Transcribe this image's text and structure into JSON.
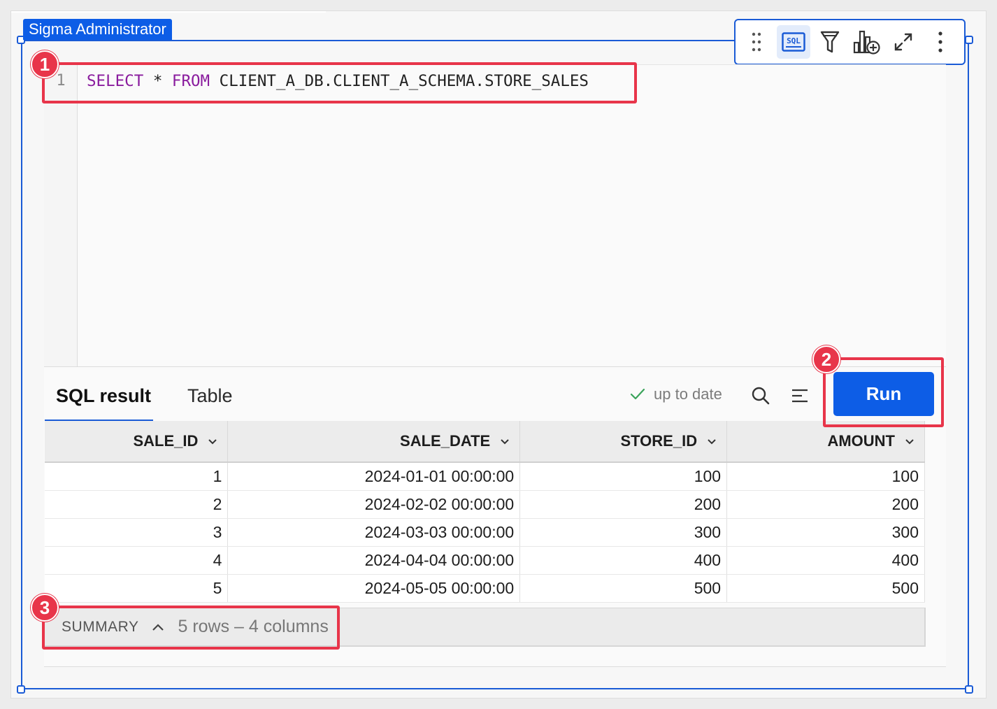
{
  "owner_tag": "Sigma Administrator",
  "toolbar": {
    "items": [
      {
        "icon": "drag-handle-icon"
      },
      {
        "icon": "sql-icon",
        "label": "SQL",
        "active": true
      },
      {
        "icon": "filter-icon"
      },
      {
        "icon": "add-chart-icon"
      },
      {
        "icon": "expand-icon"
      },
      {
        "icon": "more-vertical-icon"
      }
    ]
  },
  "editor": {
    "line_number": "1",
    "code": {
      "kw1": "SELECT",
      "star": " * ",
      "kw2": "FROM",
      "table": " CLIENT_A_DB.CLIENT_A_SCHEMA.STORE_SALES"
    }
  },
  "results": {
    "tabs": [
      {
        "label": "SQL result",
        "active": true
      },
      {
        "label": "Table",
        "active": false
      }
    ],
    "status": "up to date",
    "run_label": "Run"
  },
  "table": {
    "columns": [
      "SALE_ID",
      "SALE_DATE",
      "STORE_ID",
      "AMOUNT"
    ],
    "rows": [
      [
        "1",
        "2024-01-01 00:00:00",
        "100",
        "100"
      ],
      [
        "2",
        "2024-02-02 00:00:00",
        "200",
        "200"
      ],
      [
        "3",
        "2024-03-03 00:00:00",
        "300",
        "300"
      ],
      [
        "4",
        "2024-04-04 00:00:00",
        "400",
        "400"
      ],
      [
        "5",
        "2024-05-05 00:00:00",
        "500",
        "500"
      ]
    ]
  },
  "summary": {
    "label": "SUMMARY",
    "info": "5 rows – 4 columns"
  },
  "callouts": [
    "1",
    "2",
    "3"
  ],
  "colors": {
    "accent": "#0d5de6",
    "callout": "#e8354a",
    "keyword": "#8a1c9e",
    "status_check": "#3aa35a"
  }
}
